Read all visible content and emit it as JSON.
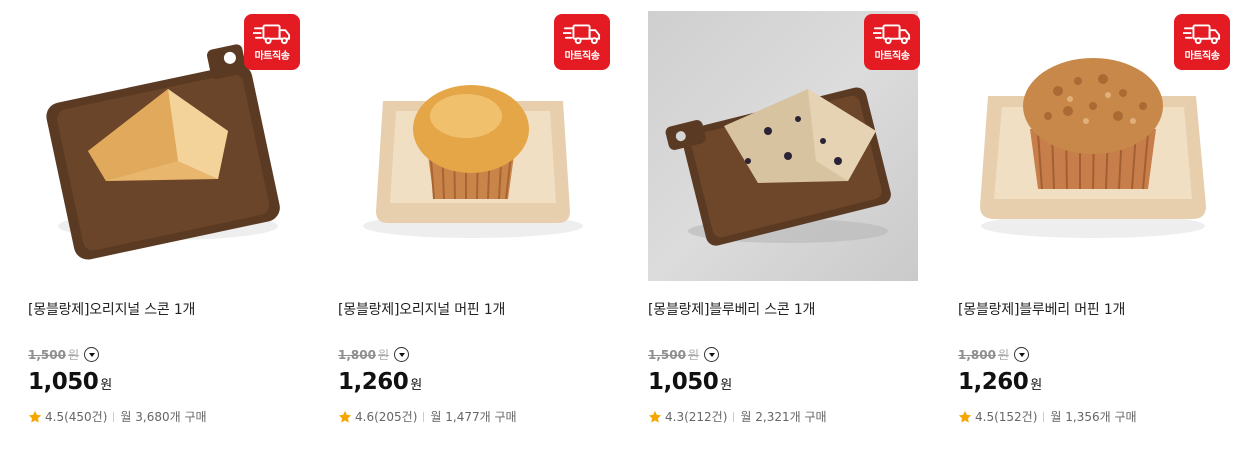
{
  "badge_label": "마트직송",
  "colors": {
    "badge": "#e41b23",
    "star": "#f5a700"
  },
  "products": [
    {
      "title": "[몽블랑제]오리지널 스콘 1개",
      "original_price": "1,500",
      "original_unit": "원",
      "price": "1,050",
      "price_unit": "원",
      "rating": "4.5",
      "reviews": "(450건)",
      "monthly": "월 3,680개 구매"
    },
    {
      "title": "[몽블랑제]오리지널 머핀 1개",
      "original_price": "1,800",
      "original_unit": "원",
      "price": "1,260",
      "price_unit": "원",
      "rating": "4.6",
      "reviews": "(205건)",
      "monthly": "월 1,477개 구매"
    },
    {
      "title": "[몽블랑제]블루베리 스콘 1개",
      "original_price": "1,500",
      "original_unit": "원",
      "price": "1,050",
      "price_unit": "원",
      "rating": "4.3",
      "reviews": "(212건)",
      "monthly": "월 2,321개 구매"
    },
    {
      "title": "[몽블랑제]블루베리 머핀 1개",
      "original_price": "1,800",
      "original_unit": "원",
      "price": "1,260",
      "price_unit": "원",
      "rating": "4.5",
      "reviews": "(152건)",
      "monthly": "월 1,356개 구매"
    }
  ]
}
